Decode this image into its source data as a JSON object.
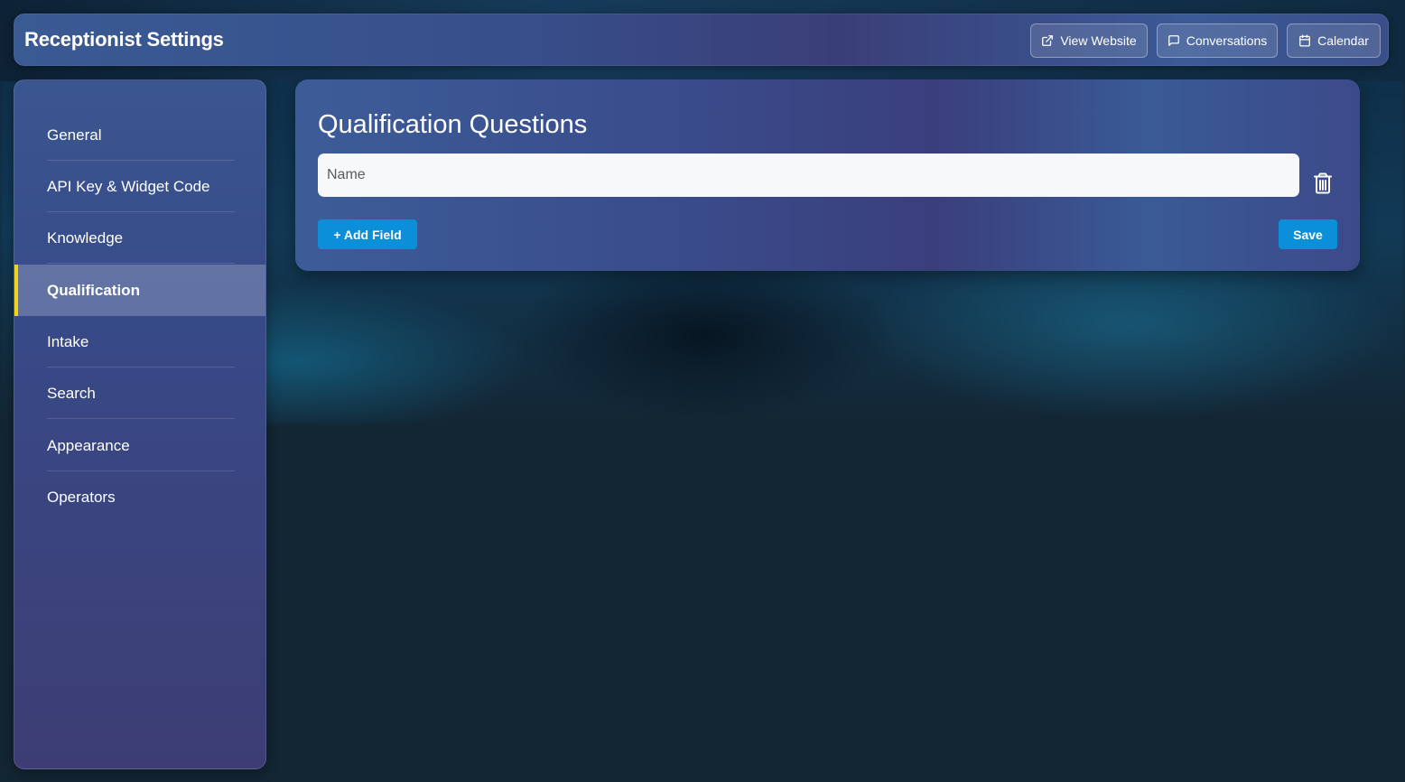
{
  "header": {
    "title": "Receptionist Settings",
    "buttons": {
      "view_website": {
        "label": "View Website",
        "icon": "external-link-icon"
      },
      "conversations": {
        "label": "Conversations",
        "icon": "chat-bubble-icon"
      },
      "calendar": {
        "label": "Calendar",
        "icon": "calendar-icon"
      }
    }
  },
  "sidebar": {
    "items": [
      {
        "label": "General"
      },
      {
        "label": "API Key & Widget Code"
      },
      {
        "label": "Knowledge"
      },
      {
        "label": "Qualification",
        "active": true
      },
      {
        "label": "Intake"
      },
      {
        "label": "Search"
      },
      {
        "label": "Appearance"
      },
      {
        "label": "Operators"
      }
    ],
    "active_indicator_color": "#f2d21b"
  },
  "main": {
    "title": "Qualification Questions",
    "fields": [
      {
        "value": "",
        "placeholder": "Name"
      }
    ],
    "add_field_label": "+ Add Field",
    "save_label": "Save"
  },
  "colors": {
    "primary_button": "#0a8fd8",
    "active_accent": "#f2d21b"
  }
}
